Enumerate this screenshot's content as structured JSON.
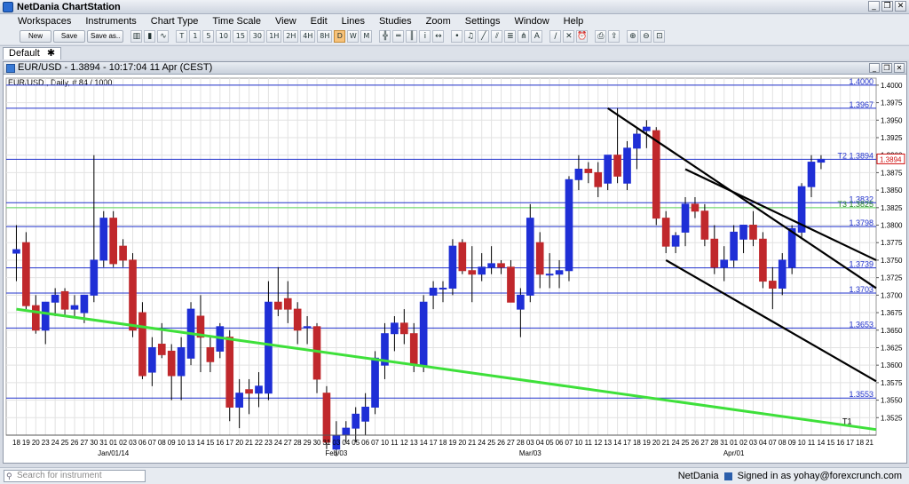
{
  "window": {
    "title": "NetDania ChartStation",
    "min": "_",
    "restore": "❐",
    "close": "✕"
  },
  "menu": [
    "Workspaces",
    "Instruments",
    "Chart Type",
    "Time Scale",
    "View",
    "Edit",
    "Lines",
    "Studies",
    "Zoom",
    "Settings",
    "Window",
    "Help"
  ],
  "toolbar": {
    "buttons": [
      "New",
      "Save",
      "Save as.."
    ],
    "timescales": [
      "T",
      "1",
      "5",
      "10",
      "15",
      "30",
      "1H",
      "2H",
      "4H",
      "8H",
      "D",
      "W",
      "M"
    ],
    "active_timescale": "D"
  },
  "workspace_tab": {
    "label": "Default",
    "icon": "pin-icon"
  },
  "chart_window": {
    "title": "EUR/USD - 1.3894 - 10:17:04  11 Apr (CEST)",
    "subtitle": "EUR/USD , Daily, # 84 / 1000"
  },
  "status": {
    "search_placeholder": "Search for instrument",
    "brand": "NetDania",
    "signed_in": "Signed in as yohay@forexcrunch.com"
  },
  "colors": {
    "up": "#1f2fd6",
    "down": "#c0282c",
    "hline": "#2233cc",
    "green": "#3ee03a",
    "green_hline": "#5ad35a",
    "price_tag": "#d01010"
  },
  "chart_data": {
    "type": "candlestick",
    "symbol": "EUR/USD",
    "ylim": [
      1.35,
      1.401
    ],
    "yticks": [
      "1.4000",
      "1.3975",
      "1.3950",
      "1.3925",
      "1.3900",
      "1.3875",
      "1.3850",
      "1.3825",
      "1.3800",
      "1.3775",
      "1.3750",
      "1.3725",
      "1.3700",
      "1.3675",
      "1.3650",
      "1.3625",
      "1.3600",
      "1.3575",
      "1.3550",
      "1.3525"
    ],
    "xticks": [
      "18",
      "19",
      "20",
      "23",
      "24",
      "25",
      "26",
      "27",
      "30",
      "31",
      "01",
      "02",
      "03",
      "06",
      "07",
      "08",
      "09",
      "10",
      "13",
      "14",
      "15",
      "16",
      "17",
      "20",
      "21",
      "22",
      "23",
      "24",
      "27",
      "28",
      "29",
      "30",
      "31",
      "03",
      "04",
      "05",
      "06",
      "07",
      "10",
      "11",
      "12",
      "13",
      "14",
      "17",
      "18",
      "19",
      "20",
      "21",
      "24",
      "25",
      "26",
      "27",
      "28",
      "03",
      "04",
      "05",
      "06",
      "07",
      "10",
      "11",
      "12",
      "13",
      "14",
      "17",
      "18",
      "19",
      "20",
      "21",
      "24",
      "25",
      "26",
      "27",
      "28",
      "31",
      "01",
      "02",
      "03",
      "04",
      "07",
      "08",
      "09",
      "10",
      "11",
      "14",
      "15",
      "16",
      "17",
      "18",
      "21"
    ],
    "month_labels": [
      {
        "label": "Jan/01/14",
        "at": 10
      },
      {
        "label": "Feb/03",
        "at": 33
      },
      {
        "label": "Mar/03",
        "at": 53
      },
      {
        "label": "Apr/01",
        "at": 74
      }
    ],
    "candles": [
      [
        1.376,
        1.38,
        1.372,
        1.3765
      ],
      [
        1.3775,
        1.379,
        1.368,
        1.3685
      ],
      [
        1.3685,
        1.37,
        1.3645,
        1.365
      ],
      [
        1.365,
        1.369,
        1.363,
        1.369
      ],
      [
        1.369,
        1.371,
        1.367,
        1.37
      ],
      [
        1.3705,
        1.371,
        1.367,
        1.368
      ],
      [
        1.368,
        1.37,
        1.367,
        1.3685
      ],
      [
        1.3675,
        1.37,
        1.366,
        1.37
      ],
      [
        1.37,
        1.39,
        1.369,
        1.375
      ],
      [
        1.375,
        1.382,
        1.374,
        1.381
      ],
      [
        1.381,
        1.382,
        1.374,
        1.3745
      ],
      [
        1.377,
        1.378,
        1.374,
        1.375
      ],
      [
        1.375,
        1.376,
        1.364,
        1.365
      ],
      [
        1.3675,
        1.369,
        1.358,
        1.3585
      ],
      [
        1.359,
        1.364,
        1.357,
        1.3625
      ],
      [
        1.363,
        1.366,
        1.361,
        1.3615
      ],
      [
        1.362,
        1.363,
        1.355,
        1.3585
      ],
      [
        1.3585,
        1.364,
        1.355,
        1.3625
      ],
      [
        1.361,
        1.369,
        1.36,
        1.368
      ],
      [
        1.367,
        1.37,
        1.359,
        1.364
      ],
      [
        1.3625,
        1.364,
        1.359,
        1.3605
      ],
      [
        1.362,
        1.366,
        1.361,
        1.3655
      ],
      [
        1.364,
        1.365,
        1.352,
        1.354
      ],
      [
        1.354,
        1.358,
        1.351,
        1.356
      ],
      [
        1.3565,
        1.358,
        1.353,
        1.356
      ],
      [
        1.356,
        1.359,
        1.354,
        1.357
      ],
      [
        1.356,
        1.372,
        1.355,
        1.369
      ],
      [
        1.369,
        1.374,
        1.367,
        1.368
      ],
      [
        1.3695,
        1.372,
        1.366,
        1.368
      ],
      [
        1.368,
        1.369,
        1.363,
        1.365
      ],
      [
        1.3655,
        1.367,
        1.363,
        1.3655
      ],
      [
        1.3655,
        1.366,
        1.356,
        1.358
      ],
      [
        1.356,
        1.357,
        1.348,
        1.349
      ],
      [
        1.348,
        1.352,
        1.347,
        1.35
      ],
      [
        1.35,
        1.352,
        1.349,
        1.351
      ],
      [
        1.351,
        1.354,
        1.349,
        1.353
      ],
      [
        1.352,
        1.356,
        1.35,
        1.354
      ],
      [
        1.354,
        1.362,
        1.353,
        1.361
      ],
      [
        1.36,
        1.366,
        1.358,
        1.3645
      ],
      [
        1.3645,
        1.367,
        1.362,
        1.366
      ],
      [
        1.366,
        1.368,
        1.363,
        1.3645
      ],
      [
        1.3645,
        1.366,
        1.359,
        1.36
      ],
      [
        1.36,
        1.37,
        1.359,
        1.369
      ],
      [
        1.37,
        1.372,
        1.368,
        1.371
      ],
      [
        1.371,
        1.372,
        1.369,
        1.371
      ],
      [
        1.371,
        1.378,
        1.37,
        1.377
      ],
      [
        1.3775,
        1.378,
        1.373,
        1.3735
      ],
      [
        1.3735,
        1.377,
        1.369,
        1.373
      ],
      [
        1.373,
        1.376,
        1.372,
        1.374
      ],
      [
        1.374,
        1.377,
        1.373,
        1.3745
      ],
      [
        1.3745,
        1.375,
        1.373,
        1.374
      ],
      [
        1.374,
        1.375,
        1.369,
        1.369
      ],
      [
        1.368,
        1.371,
        1.364,
        1.37
      ],
      [
        1.37,
        1.383,
        1.369,
        1.381
      ],
      [
        1.3775,
        1.379,
        1.371,
        1.373
      ],
      [
        1.373,
        1.376,
        1.371,
        1.373
      ],
      [
        1.373,
        1.375,
        1.371,
        1.3735
      ],
      [
        1.3735,
        1.387,
        1.372,
        1.3865
      ],
      [
        1.3865,
        1.39,
        1.385,
        1.388
      ],
      [
        1.388,
        1.389,
        1.386,
        1.3875
      ],
      [
        1.3875,
        1.389,
        1.384,
        1.3855
      ],
      [
        1.386,
        1.389,
        1.385,
        1.39
      ],
      [
        1.39,
        1.3967,
        1.386,
        1.387
      ],
      [
        1.386,
        1.392,
        1.385,
        1.391
      ],
      [
        1.391,
        1.394,
        1.388,
        1.393
      ],
      [
        1.3935,
        1.395,
        1.391,
        1.394
      ],
      [
        1.3935,
        1.394,
        1.38,
        1.381
      ],
      [
        1.381,
        1.382,
        1.376,
        1.377
      ],
      [
        1.377,
        1.379,
        1.376,
        1.3785
      ],
      [
        1.379,
        1.384,
        1.377,
        1.383
      ],
      [
        1.383,
        1.384,
        1.381,
        1.382
      ],
      [
        1.382,
        1.383,
        1.377,
        1.378
      ],
      [
        1.378,
        1.38,
        1.373,
        1.374
      ],
      [
        1.374,
        1.377,
        1.372,
        1.375
      ],
      [
        1.375,
        1.38,
        1.374,
        1.379
      ],
      [
        1.378,
        1.38,
        1.376,
        1.38
      ],
      [
        1.38,
        1.382,
        1.377,
        1.378
      ],
      [
        1.378,
        1.379,
        1.371,
        1.372
      ],
      [
        1.372,
        1.374,
        1.368,
        1.371
      ],
      [
        1.371,
        1.376,
        1.37,
        1.375
      ],
      [
        1.374,
        1.38,
        1.373,
        1.3795
      ],
      [
        1.379,
        1.386,
        1.378,
        1.3855
      ],
      [
        1.3855,
        1.39,
        1.384,
        1.389
      ],
      [
        1.389,
        1.39,
        1.388,
        1.3894
      ]
    ],
    "hlines": [
      {
        "label": "1.4000",
        "value": 1.4
      },
      {
        "label": "1.3967",
        "value": 1.3967
      },
      {
        "label": "T2 1.3894",
        "value": 1.3894
      },
      {
        "label": "1.3832",
        "value": 1.3832
      },
      {
        "label": "T3 1.3825",
        "value": 1.3825,
        "green": true
      },
      {
        "label": "1.3798",
        "value": 1.3798
      },
      {
        "label": "1.3739",
        "value": 1.3739
      },
      {
        "label": "1.3703",
        "value": 1.3703
      },
      {
        "label": "1.3653",
        "value": 1.3653
      },
      {
        "label": "1.3553",
        "value": 1.3553
      }
    ],
    "trendlines": [
      {
        "from": [
          0,
          1.368
        ],
        "to": [
          89,
          1.3508
        ],
        "color": "green",
        "label": "T1"
      },
      {
        "from": [
          61,
          1.3967
        ],
        "to": [
          89,
          1.371
        ],
        "color": "black"
      },
      {
        "from": [
          67,
          1.375
        ],
        "to": [
          89,
          1.3577
        ],
        "color": "black"
      },
      {
        "from": [
          69,
          1.388
        ],
        "to": [
          89,
          1.375
        ],
        "color": "black"
      }
    ],
    "last_price": "1.3894"
  }
}
